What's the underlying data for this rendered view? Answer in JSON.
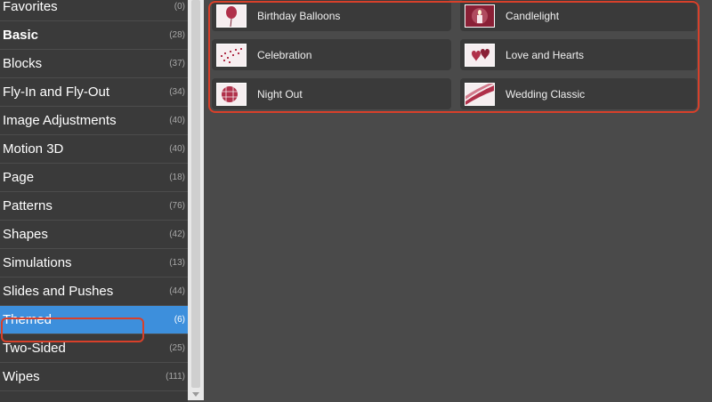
{
  "sidebar": {
    "categories": [
      {
        "name": "Favorites",
        "count": "(0)"
      },
      {
        "name": "Basic",
        "count": "(28)"
      },
      {
        "name": "Blocks",
        "count": "(37)"
      },
      {
        "name": "Fly-In and Fly-Out",
        "count": "(34)"
      },
      {
        "name": "Image Adjustments",
        "count": "(40)"
      },
      {
        "name": "Motion 3D",
        "count": "(40)"
      },
      {
        "name": "Page",
        "count": "(18)"
      },
      {
        "name": "Patterns",
        "count": "(76)"
      },
      {
        "name": "Shapes",
        "count": "(42)"
      },
      {
        "name": "Simulations",
        "count": "(13)"
      },
      {
        "name": "Slides and Pushes",
        "count": "(44)"
      },
      {
        "name": "Themed",
        "count": "(6)"
      },
      {
        "name": "Two-Sided",
        "count": "(25)"
      },
      {
        "name": "Wipes",
        "count": "(111)"
      }
    ],
    "selected": "Themed"
  },
  "transitions": [
    {
      "name": "Birthday Balloons",
      "icon": "balloon-icon"
    },
    {
      "name": "Candlelight",
      "icon": "candle-icon"
    },
    {
      "name": "Celebration",
      "icon": "confetti-icon"
    },
    {
      "name": "Love and Hearts",
      "icon": "hearts-icon"
    },
    {
      "name": "Night Out",
      "icon": "disco-ball-icon"
    },
    {
      "name": "Wedding Classic",
      "icon": "ribbon-icon"
    }
  ],
  "colors": {
    "selected": "#3d8fdc",
    "highlight": "#d8402a",
    "thumb_accent": "#b0304a"
  }
}
